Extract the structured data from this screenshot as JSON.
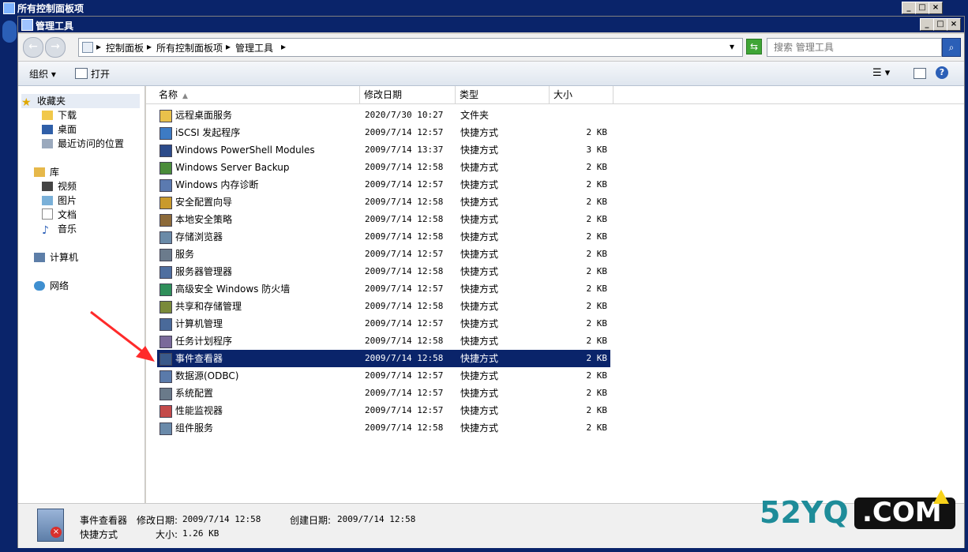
{
  "background_window": {
    "title": "所有控制面板项"
  },
  "window": {
    "title": "管理工具"
  },
  "address": {
    "crumbs": [
      "控制面板",
      "所有控制面板项",
      "管理工具"
    ]
  },
  "search": {
    "placeholder": "搜索 管理工具"
  },
  "toolbar": {
    "organize": "组织",
    "open": "打开"
  },
  "nav": {
    "favorites": "收藏夹",
    "favorites_items": [
      "下载",
      "桌面",
      "最近访问的位置"
    ],
    "libraries": "库",
    "libraries_items": [
      "视频",
      "图片",
      "文档",
      "音乐"
    ],
    "computer": "计算机",
    "network": "网络"
  },
  "columns": {
    "name": "名称",
    "date": "修改日期",
    "type": "类型",
    "size": "大小"
  },
  "files": [
    {
      "name": "远程桌面服务",
      "date": "2020/7/30 10:27",
      "type": "文件夹",
      "size": ""
    },
    {
      "name": "iSCSI 发起程序",
      "date": "2009/7/14 12:57",
      "type": "快捷方式",
      "size": "2 KB"
    },
    {
      "name": "Windows PowerShell Modules",
      "date": "2009/7/14 13:37",
      "type": "快捷方式",
      "size": "3 KB"
    },
    {
      "name": "Windows Server Backup",
      "date": "2009/7/14 12:58",
      "type": "快捷方式",
      "size": "2 KB"
    },
    {
      "name": "Windows 内存诊断",
      "date": "2009/7/14 12:57",
      "type": "快捷方式",
      "size": "2 KB"
    },
    {
      "name": "安全配置向导",
      "date": "2009/7/14 12:58",
      "type": "快捷方式",
      "size": "2 KB"
    },
    {
      "name": "本地安全策略",
      "date": "2009/7/14 12:58",
      "type": "快捷方式",
      "size": "2 KB"
    },
    {
      "name": "存储浏览器",
      "date": "2009/7/14 12:58",
      "type": "快捷方式",
      "size": "2 KB"
    },
    {
      "name": "服务",
      "date": "2009/7/14 12:57",
      "type": "快捷方式",
      "size": "2 KB"
    },
    {
      "name": "服务器管理器",
      "date": "2009/7/14 12:58",
      "type": "快捷方式",
      "size": "2 KB"
    },
    {
      "name": "高级安全 Windows 防火墙",
      "date": "2009/7/14 12:57",
      "type": "快捷方式",
      "size": "2 KB"
    },
    {
      "name": "共享和存储管理",
      "date": "2009/7/14 12:58",
      "type": "快捷方式",
      "size": "2 KB"
    },
    {
      "name": "计算机管理",
      "date": "2009/7/14 12:57",
      "type": "快捷方式",
      "size": "2 KB"
    },
    {
      "name": "任务计划程序",
      "date": "2009/7/14 12:58",
      "type": "快捷方式",
      "size": "2 KB"
    },
    {
      "name": "事件查看器",
      "date": "2009/7/14 12:58",
      "type": "快捷方式",
      "size": "2 KB"
    },
    {
      "name": "数据源(ODBC)",
      "date": "2009/7/14 12:57",
      "type": "快捷方式",
      "size": "2 KB"
    },
    {
      "name": "系统配置",
      "date": "2009/7/14 12:57",
      "type": "快捷方式",
      "size": "2 KB"
    },
    {
      "name": "性能监视器",
      "date": "2009/7/14 12:57",
      "type": "快捷方式",
      "size": "2 KB"
    },
    {
      "name": "组件服务",
      "date": "2009/7/14 12:58",
      "type": "快捷方式",
      "size": "2 KB"
    }
  ],
  "selected_index": 14,
  "status": {
    "name": "事件查看器",
    "modified_label": "修改日期:",
    "modified": "2009/7/14 12:58",
    "created_label": "创建日期:",
    "created": "2009/7/14 12:58",
    "type": "快捷方式",
    "size_label": "大小:",
    "size": "1.26 KB"
  },
  "watermark": {
    "text": "52YQ",
    "suffix": ".COM"
  },
  "colors": {
    "title_bar": "#0a246a",
    "selection": "#0a246a",
    "arrow": "#ff2a2a",
    "watermark": "#1e8c99"
  }
}
